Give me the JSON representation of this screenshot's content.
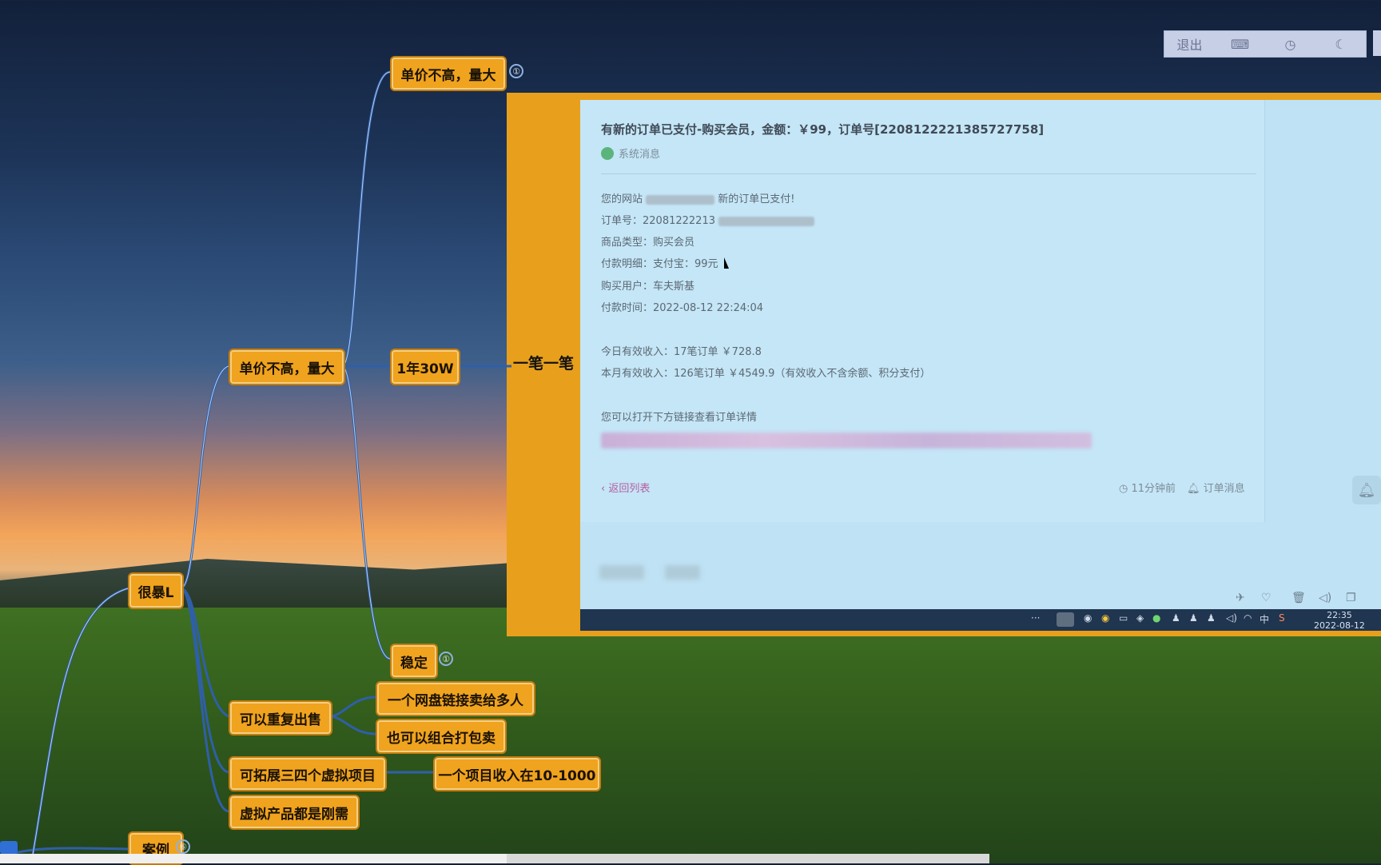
{
  "toolbar": {
    "exit_label": "退出",
    "keyboard_icon": "keyboard-icon",
    "clock_icon": "clock-icon",
    "moon_icon": "moon-icon"
  },
  "mindmap": {
    "nodes": {
      "top_price": "单价不高，量大",
      "mid_price": "单价不高，量大",
      "year": "1年30W",
      "stable": "稳定",
      "root": "很暴L",
      "repeat": "可以重复出售",
      "link_many": "一个网盘链接卖给多人",
      "bundle": "也可以组合打包卖",
      "expand": "可拓展三四个虚拟项目",
      "income": "一个项目收入在10-1000",
      "need": "虚拟产品都是刚需",
      "case": "案例",
      "panel_label": "一笔一笔"
    },
    "badges": {
      "top": "①",
      "stable": "①",
      "case": "⑥"
    }
  },
  "order": {
    "title": "有新的订单已支付-购买会员，金额：￥99，订单号[2208122221385727758]",
    "source": "系统消息",
    "line_site_prefix": "您的网站",
    "line_site_suffix": "新的订单已支付!",
    "line_order": "订单号：22081222213",
    "line_type": "商品类型：购买会员",
    "line_pay": "付款明细：支付宝：99元",
    "line_user": "购买用户：车夫斯基",
    "line_time": "付款时间：2022-08-12 22:24:04",
    "line_today": "今日有效收入：17笔订单 ￥728.8",
    "line_month": "本月有效收入：126笔订单 ￥4549.9（有效收入不含余额、积分支付）",
    "line_link": "您可以打开下方链接查看订单详情",
    "back": "‹ 返回列表",
    "time_ago": "11分钟前",
    "category": "订单消息"
  },
  "taskbar": {
    "ime": "中",
    "time": "22:35",
    "date": "2022-08-12"
  }
}
